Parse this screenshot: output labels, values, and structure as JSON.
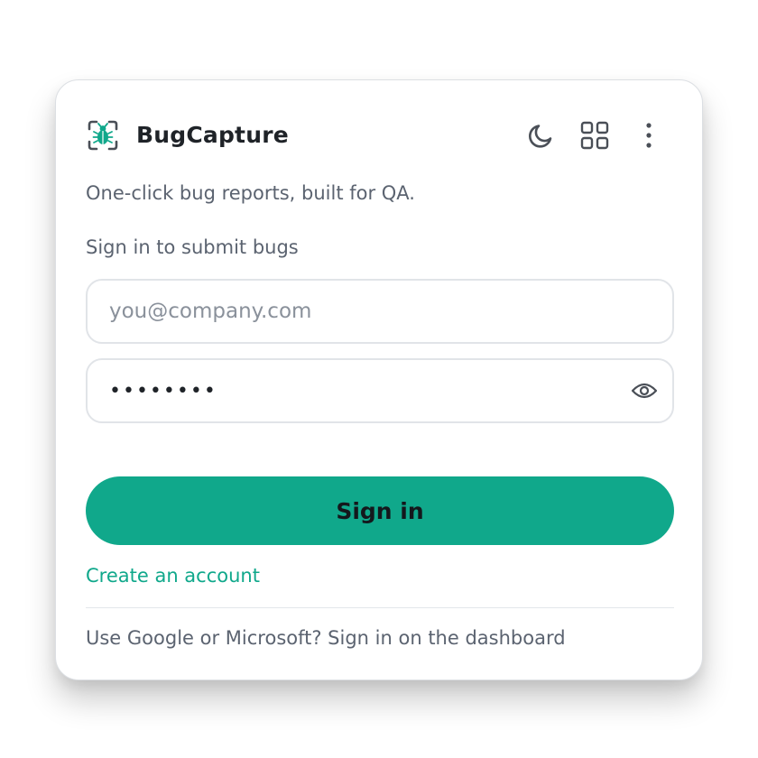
{
  "app": {
    "title": "BugCapture",
    "tagline": "One-click bug reports, built for QA.",
    "logo_icon": "bug-capture-logo-icon"
  },
  "header": {
    "actions": [
      {
        "name": "theme-toggle-button",
        "icon": "moon-icon"
      },
      {
        "name": "apps-button",
        "icon": "grid-icon"
      },
      {
        "name": "more-button",
        "icon": "more-vertical-icon"
      }
    ]
  },
  "login": {
    "section_label": "Sign in to submit bugs",
    "email": {
      "placeholder": "you@company.com",
      "value": ""
    },
    "password": {
      "value": "••••••••",
      "reveal_icon": "eye-icon"
    },
    "submit_label": "Sign in",
    "create_account_label": "Create an account",
    "sso_note": "Use Google or Microsoft? Sign in on the dashboard"
  },
  "colors": {
    "accent": "#10a88b",
    "text_primary": "#1f2328",
    "text_secondary": "#5b6370",
    "border": "#e1e4e8"
  }
}
